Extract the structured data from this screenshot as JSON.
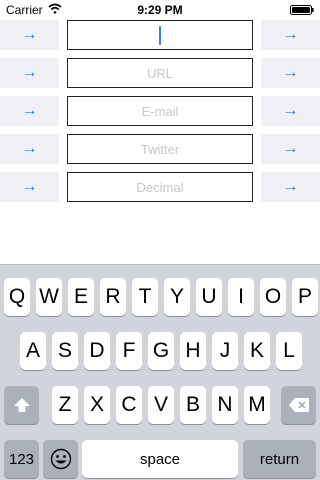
{
  "status_bar": {
    "carrier": "Carrier",
    "time": "9:29 PM",
    "wifi_icon": "wifi-icon",
    "battery_icon": "battery-icon"
  },
  "form": {
    "arrow_glyph": "→",
    "rows": [
      {
        "placeholder": "",
        "focused": true
      },
      {
        "placeholder": "URL",
        "focused": false
      },
      {
        "placeholder": "E-mail",
        "focused": false
      },
      {
        "placeholder": "Twitter",
        "focused": false
      },
      {
        "placeholder": "Decimal",
        "focused": false
      }
    ]
  },
  "keyboard": {
    "row1": [
      "Q",
      "W",
      "E",
      "R",
      "T",
      "Y",
      "U",
      "I",
      "O",
      "P"
    ],
    "row2": [
      "A",
      "S",
      "D",
      "F",
      "G",
      "H",
      "J",
      "K",
      "L"
    ],
    "row3": [
      "Z",
      "X",
      "C",
      "V",
      "B",
      "N",
      "M"
    ],
    "shift_icon": "shift-arrow-icon",
    "delete_icon": "delete-backspace-icon",
    "numbers_label": "123",
    "emoji_icon": "emoji-smiley-icon",
    "space_label": "space",
    "return_label": "return"
  },
  "colors": {
    "accent": "#1a7cf0",
    "keyboard_bg": "#d1d5db",
    "dark_key": "#abb1ba",
    "arrow_bg": "#efeff4"
  }
}
